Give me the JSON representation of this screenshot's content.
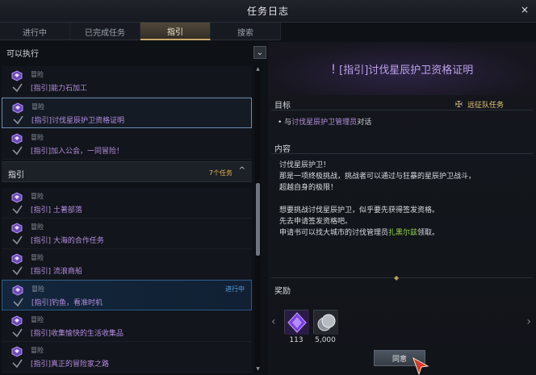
{
  "window": {
    "title": "任务日志",
    "close": "×"
  },
  "tabs": [
    "进行中",
    "已完成任务",
    "指引",
    "搜索"
  ],
  "filter": {
    "label": "可以执行",
    "chevron": "⌄"
  },
  "section_available": [
    {
      "category": "冒险",
      "title": "[指引]能力石加工",
      "status": ""
    },
    {
      "category": "冒险",
      "title": "[指引]讨伐星辰护卫资格证明",
      "status": ""
    },
    {
      "category": "冒险",
      "title": "[指引]加入公会，一同冒险！",
      "status": ""
    }
  ],
  "section_guide": {
    "header": "指引",
    "count": "7个任务",
    "chevron": "^"
  },
  "guide_items": [
    {
      "category": "冒险",
      "title": "[指引] 土著部落",
      "status": ""
    },
    {
      "category": "冒险",
      "title": "[指引] 大海的合作任务",
      "status": ""
    },
    {
      "category": "冒险",
      "title": "[指引] 流浪商船",
      "status": ""
    },
    {
      "category": "冒险",
      "title": "[指引]钓鱼，看准时机",
      "status": "进行中"
    },
    {
      "category": "冒险",
      "title": "[指引]收集愉快的生活收集品",
      "status": ""
    },
    {
      "category": "冒险",
      "title": "[指引]真正的冒险家之路",
      "status": ""
    }
  ],
  "detail": {
    "title_icon": "!",
    "title": "[指引]讨伐星辰护卫资格证明",
    "goal_label": "目标",
    "party_label": "远征队任务",
    "goal_prefix": "• 与",
    "goal_target": "讨伐星辰护卫管理员",
    "goal_suffix": "对话",
    "content_label": "内容",
    "content_lines": [
      "讨伐星辰护卫！",
      "那是一项终极挑战，挑战者可以通过与狂暴的星辰护卫战斗，",
      "超越自身的极限！",
      "",
      "想要挑战讨伐星辰护卫，似乎要先获得签发资格。",
      "先去申请签发资格吧。"
    ],
    "content_last_prefix": "申请书可以找大城市的讨伐管理员",
    "content_last_npc": "扎黑尔兹",
    "content_last_suffix": "领取。",
    "reward_label": "奖励",
    "rewards": [
      {
        "icon": "purple-gem-icon",
        "value": "113"
      },
      {
        "icon": "silver-coin-icon",
        "value": "5,000"
      }
    ],
    "accept_label": "同意",
    "nav_prev": "‹",
    "nav_next": "›"
  },
  "colors": {
    "accent_gold": "#c9a86a",
    "quest_purple": "#b48de0",
    "npc_green": "#8fd14f",
    "progress_blue": "#5aa0e6"
  }
}
